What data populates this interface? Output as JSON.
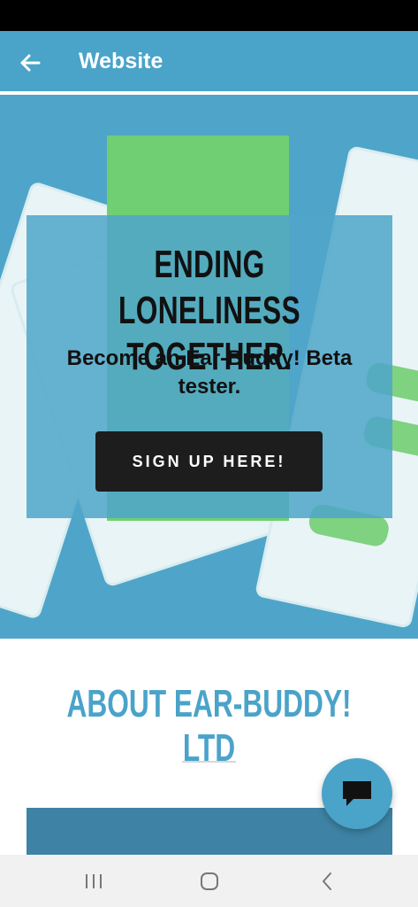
{
  "app_bar": {
    "title": "Website",
    "back_icon": "arrow-left-icon"
  },
  "hero": {
    "headline": "ENDING LONELINESS TOGETHER.",
    "subheadline": "Become an Ear-Buddy! Beta tester.",
    "cta_label": "SIGN UP HERE!"
  },
  "about": {
    "title": "ABOUT EAR-BUDDY! LTD"
  },
  "fab": {
    "icon": "chat-icon"
  },
  "nav": {
    "recents_icon": "recents-icon",
    "home_icon": "home-icon",
    "back_icon": "back-icon"
  },
  "colors": {
    "app_bar": "#4aa3c9",
    "hero_bg": "#4ea5c9",
    "green_accent": "#6fcf72",
    "about_title": "#4aa3c9",
    "button_bg": "#1d1d1d"
  }
}
